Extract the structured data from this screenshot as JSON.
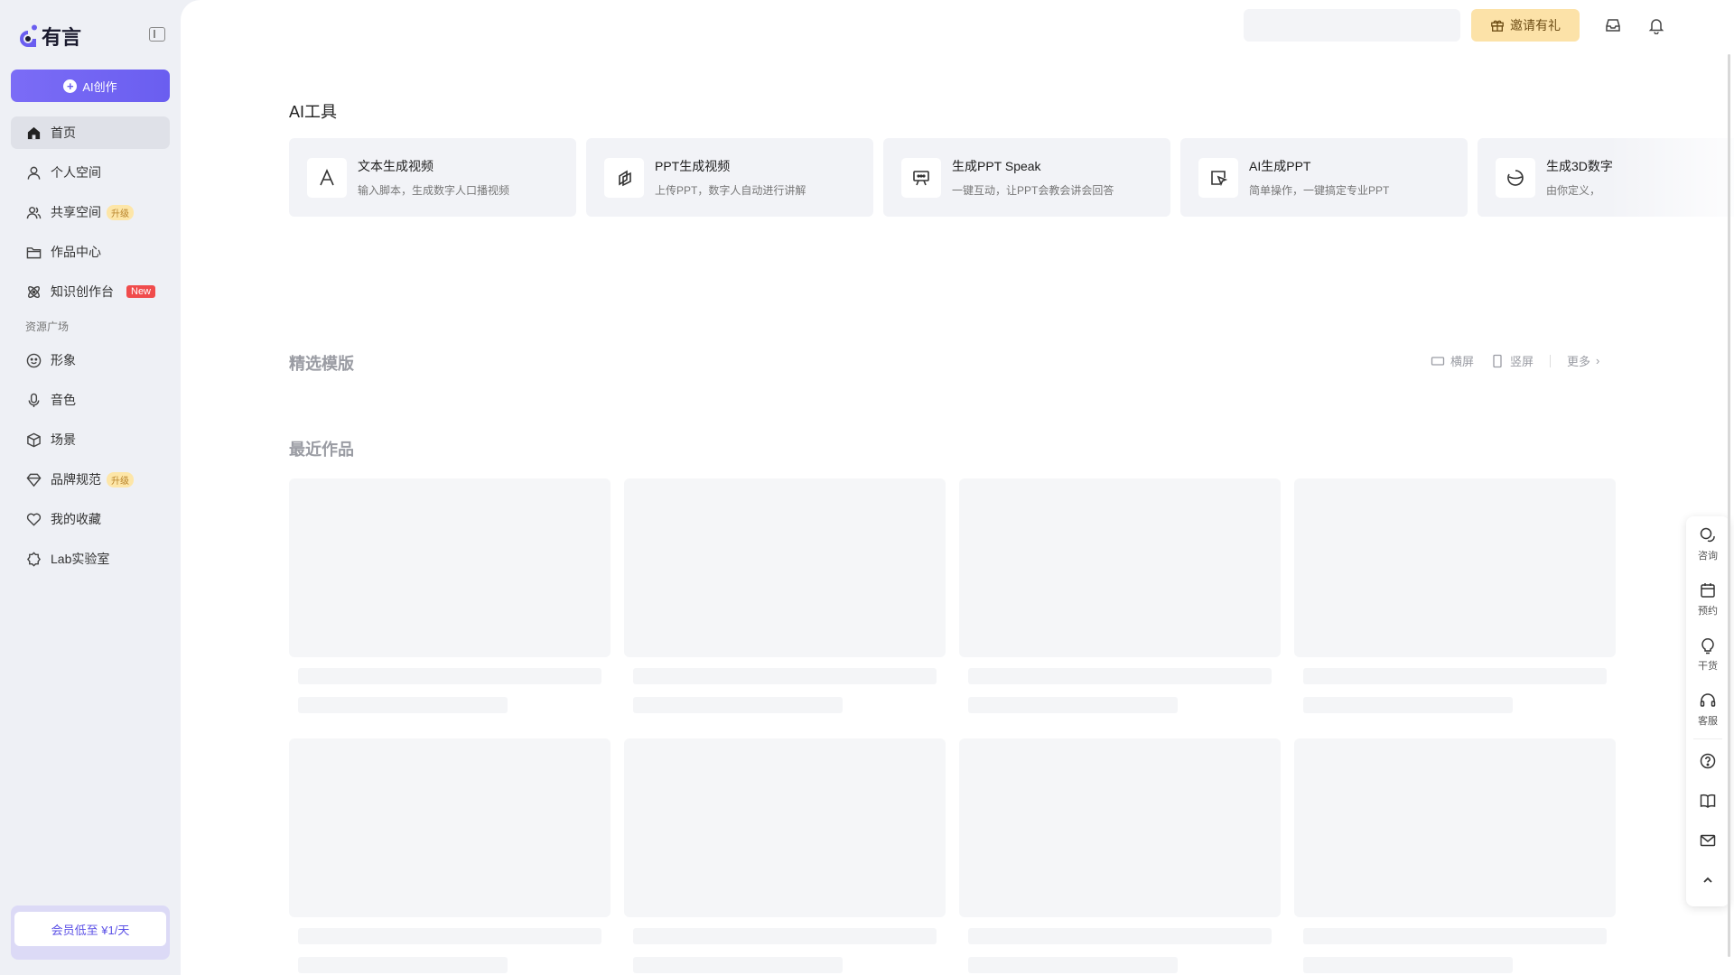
{
  "brand": {
    "name": "有言",
    "accent": "#6a5ef0"
  },
  "sidebar": {
    "create_label": "AI创作",
    "items": [
      {
        "label": "首页",
        "icon": "home-icon",
        "active": true
      },
      {
        "label": "个人空间",
        "icon": "user-icon"
      },
      {
        "label": "共享空间",
        "icon": "users-icon",
        "badge": "升级"
      },
      {
        "label": "作品中心",
        "icon": "folder-icon"
      },
      {
        "label": "知识创作台",
        "icon": "atom-icon",
        "badge": "New"
      }
    ],
    "section_label": "资源广场",
    "resources": [
      {
        "label": "形象",
        "icon": "smile-icon"
      },
      {
        "label": "音色",
        "icon": "mic-icon"
      },
      {
        "label": "场景",
        "icon": "box-icon"
      },
      {
        "label": "品牌规范",
        "icon": "diamond-icon",
        "badge": "升级"
      },
      {
        "label": "我的收藏",
        "icon": "heart-icon"
      },
      {
        "label": "Lab实验室",
        "icon": "badge-icon"
      }
    ],
    "member_label": "会员低至 ¥1/天"
  },
  "topbar": {
    "search_placeholder": "",
    "invite_label": "邀请有礼"
  },
  "ai_tools": {
    "title": "AI工具",
    "cards": [
      {
        "title": "文本生成视频",
        "desc": "输入脚本，生成数字人口播视频",
        "icon": "text-a-icon"
      },
      {
        "title": "PPT生成视频",
        "desc": "上传PPT，数字人自动进行讲解",
        "icon": "ppt-video-icon"
      },
      {
        "title": "生成PPT Speak",
        "desc": "一键互动，让PPT会教会讲会回答",
        "icon": "presentation-icon"
      },
      {
        "title": "AI生成PPT",
        "desc": "简单操作，一键搞定专业PPT",
        "icon": "ai-ppt-icon"
      },
      {
        "title": "生成3D数字",
        "desc": "由你定义，",
        "icon": "3d-icon"
      }
    ]
  },
  "templates": {
    "title": "精选模版",
    "landscape_label": "横屏",
    "portrait_label": "竖屏",
    "more_label": "更多"
  },
  "recent": {
    "title": "最近作品"
  },
  "float_bar": {
    "items": [
      {
        "label": "咨询",
        "icon": "chat-icon"
      },
      {
        "label": "预约",
        "icon": "calendar-icon"
      },
      {
        "label": "干货",
        "icon": "bulb-icon"
      },
      {
        "label": "客服",
        "icon": "headset-icon"
      }
    ]
  }
}
